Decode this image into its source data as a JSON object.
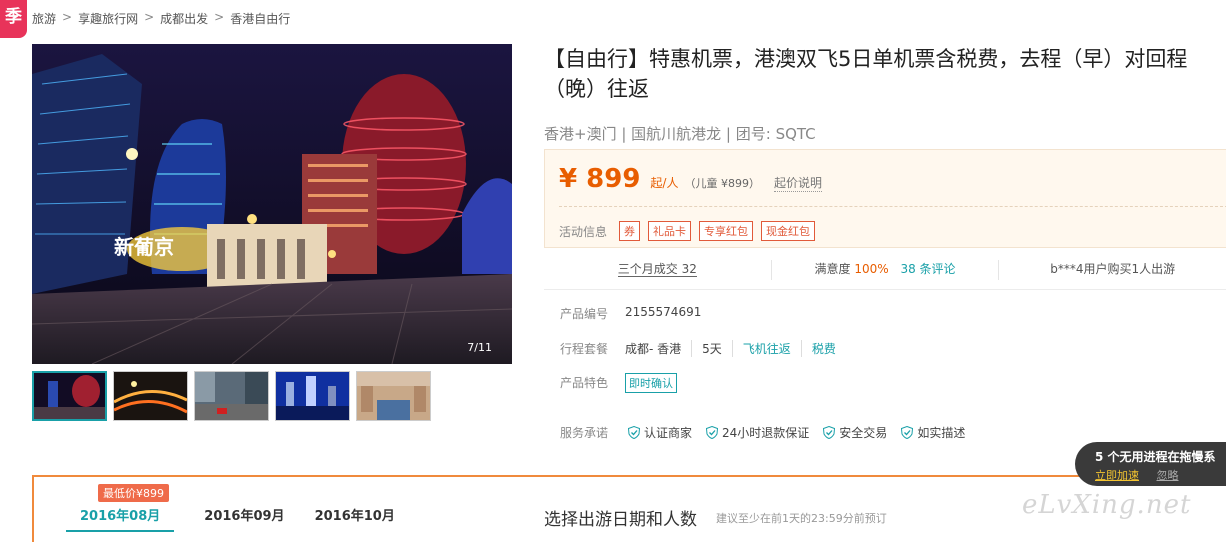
{
  "badge": {
    "text": "季"
  },
  "breadcrumb": {
    "items": [
      "旅游",
      "享趣旅行网",
      "成都出发",
      "香港自由行"
    ],
    "separator": ">"
  },
  "gallery": {
    "counter": "7/11",
    "thumbnail_count": 5
  },
  "product": {
    "title": "【自由行】特惠机票，港澳双飞5日单机票含税费，去程（早）对回程（晚）往返",
    "subinfo": "香港+澳门 | 国航川航港龙 | 团号: SQTC"
  },
  "price": {
    "amount": "¥ 899",
    "unit": "起/人",
    "child": "（儿童 ¥899）",
    "note_link": "起价说明",
    "promo_label": "活动信息",
    "promo_tags": [
      "券",
      "礼品卡",
      "专享红包",
      "现金红包"
    ]
  },
  "stats": {
    "deals": "三个月成交 32",
    "satisfaction_label": "满意度",
    "satisfaction_value": "100%",
    "reviews": "38 条评论",
    "recent": "b***4用户购买1人出游"
  },
  "attributes": {
    "code_label": "产品编号",
    "code_value": "2155574691",
    "itinerary_label": "行程套餐",
    "itinerary_items": [
      "成都- 香港",
      "5天",
      "飞机往返",
      "税费"
    ],
    "feature_label": "产品特色",
    "feature_value": "即时确认",
    "service_label": "服务承诺",
    "service_items": [
      "认证商家",
      "24小时退款保证",
      "安全交易",
      "如实描述"
    ]
  },
  "calendar": {
    "lowest_price": "最低价¥899",
    "months": [
      "2016年08月",
      "2016年09月",
      "2016年10月"
    ],
    "choose_title": "选择出游日期和人数",
    "choose_note": "建议至少在前1天的23:59分前预订"
  },
  "toast": {
    "message": "5 个无用进程在拖慢系",
    "action": "立即加速",
    "ignore": "忽略"
  },
  "watermark": "eLvXing.net",
  "colors": {
    "accent_teal": "#19a0a8",
    "price_orange": "#e85d00",
    "promo_red": "#e15a3a",
    "badge_pink": "#e8335a"
  }
}
